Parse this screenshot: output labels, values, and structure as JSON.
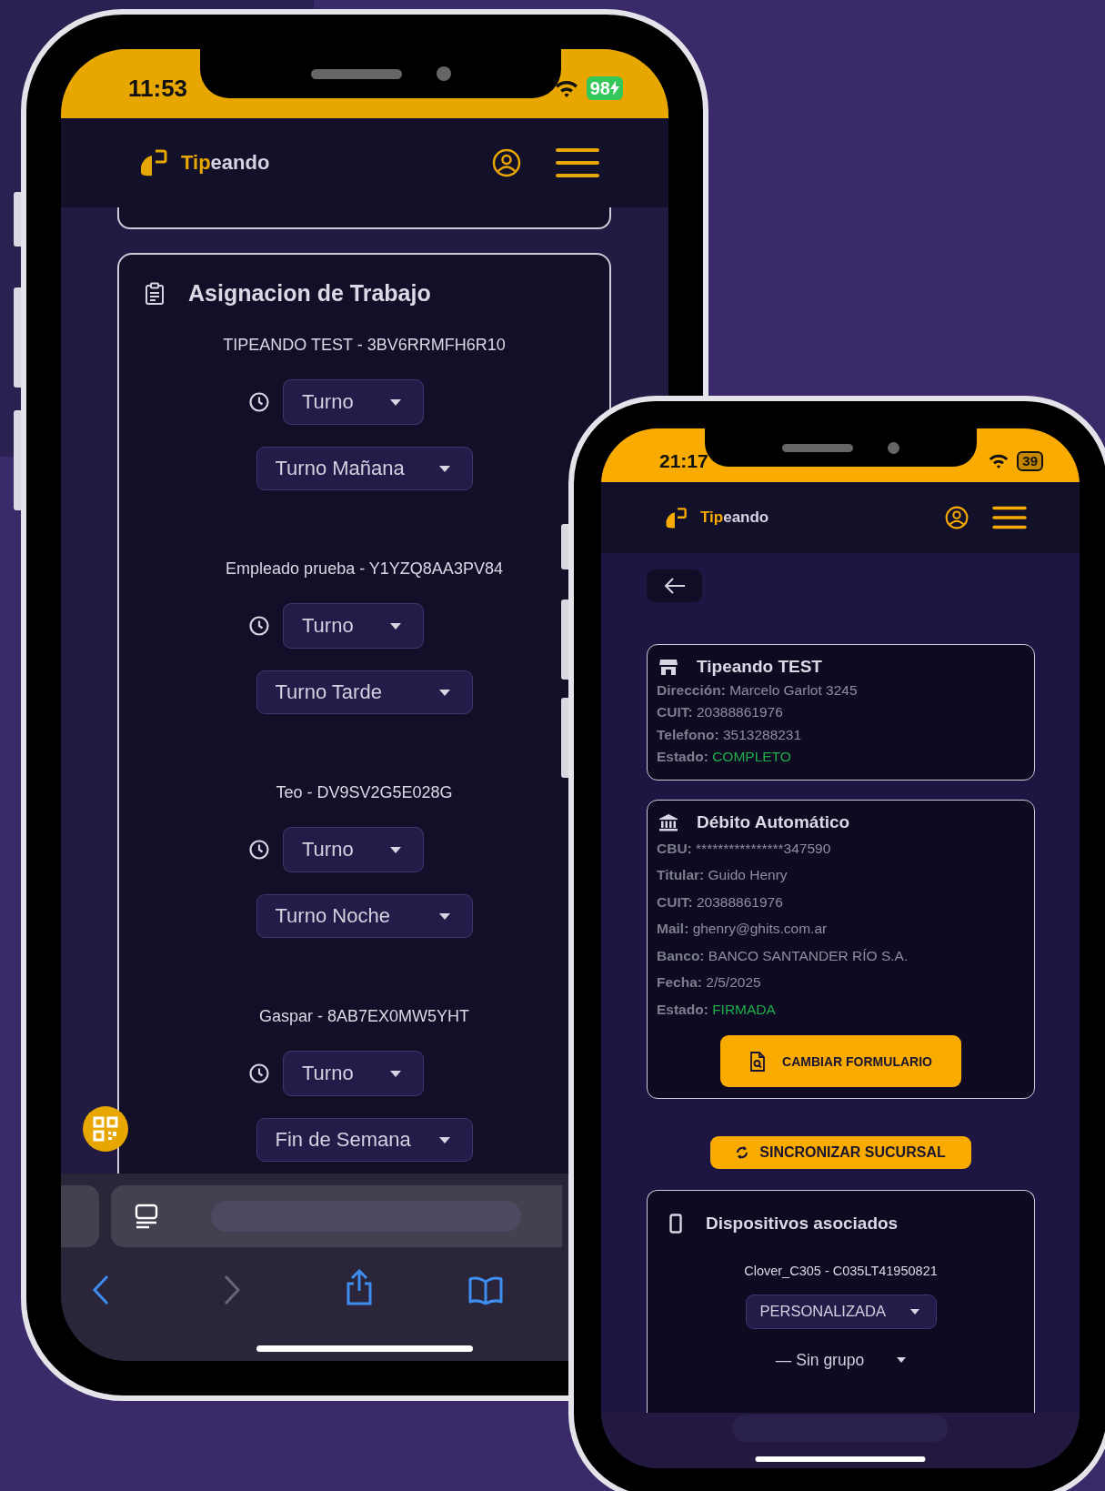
{
  "left_phone": {
    "status_bar": {
      "time": "11:53",
      "battery": "98",
      "charging": true
    },
    "header": {
      "brand_highlight": "Tip",
      "brand_rest": "eando"
    },
    "work_assignment": {
      "title": "Asignacion de Trabajo",
      "employees": [
        {
          "name": "TIPEANDO TEST - 3BV6RRMFH6R10",
          "shift_type": "Turno",
          "shift": "Turno Mañana"
        },
        {
          "name": "Empleado prueba - Y1YZQ8AA3PV84",
          "shift_type": "Turno",
          "shift": "Turno Tarde"
        },
        {
          "name": "Teo - DV9SV2G5E028G",
          "shift_type": "Turno",
          "shift": "Turno Noche"
        },
        {
          "name": "Gaspar - 8AB7EX0MW5YHT",
          "shift_type": "Turno",
          "shift": "Fin de Semana"
        }
      ]
    },
    "browser_toolbar": {
      "back_enabled": true,
      "forward_enabled": false
    }
  },
  "right_phone": {
    "status_bar": {
      "time": "21:17",
      "battery": "39",
      "charging": false
    },
    "header": {
      "brand_highlight": "Tip",
      "brand_rest": "eando"
    },
    "store_card": {
      "title": "Tipeando TEST",
      "fields": [
        {
          "label": "Dirección:",
          "value": "Marcelo Garlot 3245",
          "kind": "text"
        },
        {
          "label": "CUIT:",
          "value": "20388861976",
          "kind": "text"
        },
        {
          "label": "Telefono:",
          "value": "3513288231",
          "kind": "text"
        },
        {
          "label": "Estado:",
          "value": "COMPLETO",
          "kind": "status"
        }
      ]
    },
    "debit_card": {
      "title": "Débito Automático",
      "fields": [
        {
          "label": "CBU:",
          "value": "****************347590",
          "kind": "text"
        },
        {
          "label": "Titular:",
          "value": "Guido Henry",
          "kind": "text"
        },
        {
          "label": "CUIT:",
          "value": "20388861976",
          "kind": "text"
        },
        {
          "label": "Mail:",
          "value": "ghenry@ghits.com.ar",
          "kind": "text"
        },
        {
          "label": "Banco:",
          "value": "BANCO SANTANDER RÍO S.A.",
          "kind": "text"
        },
        {
          "label": "Fecha:",
          "value": "2/5/2025",
          "kind": "text"
        },
        {
          "label": "Estado:",
          "value": "FIRMADA",
          "kind": "status"
        }
      ],
      "button": "CAMBIAR FORMULARIO"
    },
    "sync_button": "SINCRONIZAR SUCURSAL",
    "devices_card": {
      "title": "Dispositivos asociados",
      "device": "Clover_C305 - C035LT41950821",
      "mode": "PERSONALIZADA",
      "group": "— Sin grupo"
    }
  }
}
